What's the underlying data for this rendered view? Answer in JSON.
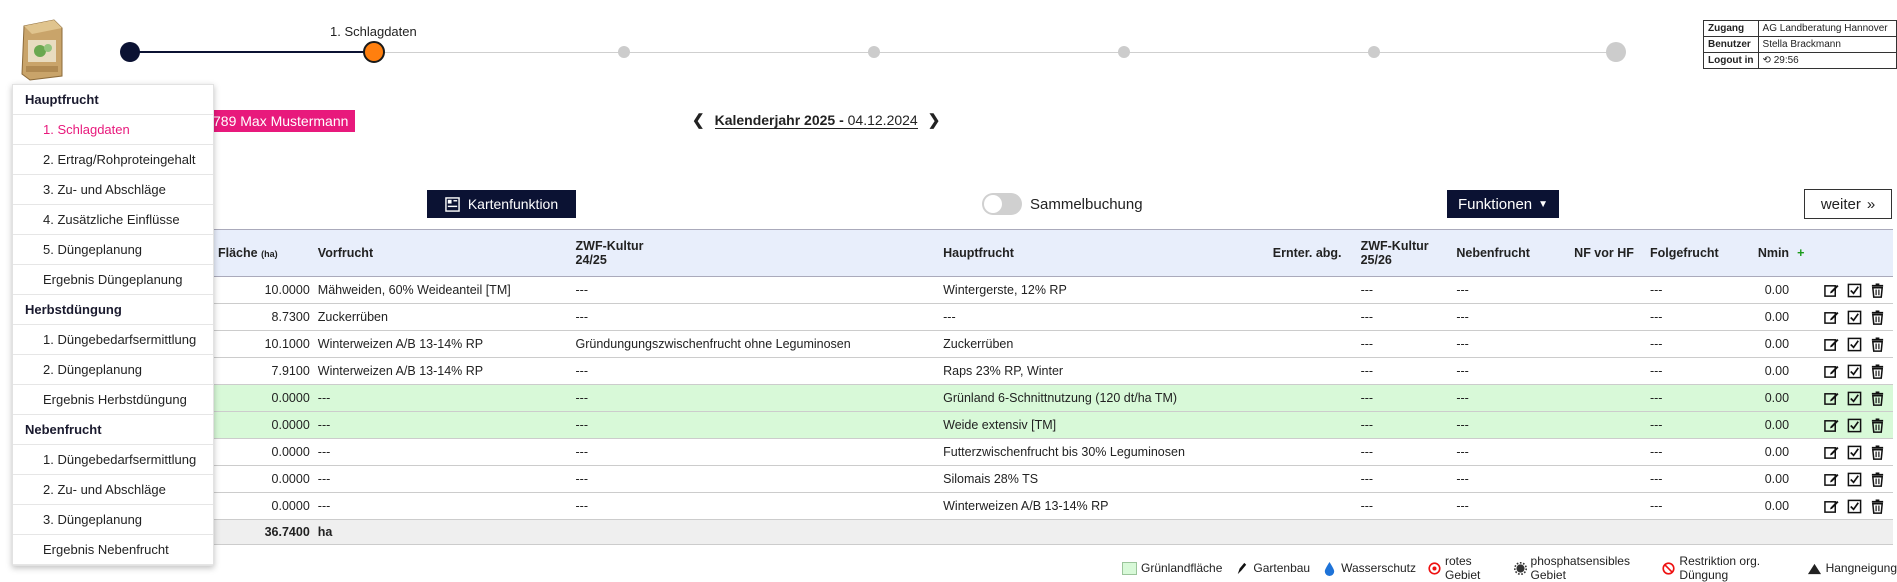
{
  "stepper": {
    "active_label": "1. Schlagdaten"
  },
  "session": [
    {
      "key": "Zugang",
      "value": "AG Landberatung Hannover"
    },
    {
      "key": "Benutzer",
      "value": "Stella Brackmann"
    },
    {
      "key": "Logout in",
      "value": "29:56"
    }
  ],
  "user_badge": "789 Max Mustermann",
  "year_nav": {
    "label": "Kalenderjahr 2025 - ",
    "date": "04.12.2024"
  },
  "toolbar": {
    "karten_label": "Kartenfunktion",
    "sammel_label": "Sammelbuchung",
    "funktionen_label": "Funktionen",
    "weiter_label": "weiter",
    "weiter_suffix": "»"
  },
  "table": {
    "headers": {
      "flaeche": "Fläche",
      "flaeche_unit": "(ha)",
      "vorfrucht": "Vorfrucht",
      "zwf1": "ZWF-Kultur",
      "zwf1_year": "24/25",
      "hauptfrucht": "Hauptfrucht",
      "ernter": "Ernter. abg.",
      "zwf2": "ZWF-Kultur",
      "zwf2_year": "25/26",
      "nebenfrucht": "Nebenfrucht",
      "nfvorhf": "NF vor HF",
      "folgefrucht": "Folgefrucht",
      "nmin": "Nmin",
      "add": "+"
    },
    "rows": [
      {
        "flaeche": "10.0000",
        "vorfrucht": "Mähweiden, 60% Weideanteil [TM]",
        "zwf1": "---",
        "hauptfrucht": "Wintergerste, 12% RP",
        "ernter": "",
        "zwf2": "---",
        "nebenfrucht": "---",
        "nfvorhf": "",
        "folgefrucht": "---",
        "nmin": "0.00",
        "green": false
      },
      {
        "flaeche": "8.7300",
        "vorfrucht": "Zuckerrüben",
        "zwf1": "---",
        "hauptfrucht": "---",
        "ernter": "",
        "zwf2": "---",
        "nebenfrucht": "---",
        "nfvorhf": "",
        "folgefrucht": "---",
        "nmin": "0.00",
        "green": false
      },
      {
        "flaeche": "10.1000",
        "vorfrucht": "Winterweizen A/B 13-14% RP",
        "zwf1": "Gründungungszwischenfrucht ohne Leguminosen",
        "hauptfrucht": "Zuckerrüben",
        "ernter": "",
        "zwf2": "---",
        "nebenfrucht": "---",
        "nfvorhf": "",
        "folgefrucht": "---",
        "nmin": "0.00",
        "green": false
      },
      {
        "flaeche": "7.9100",
        "vorfrucht": "Winterweizen A/B 13-14% RP",
        "zwf1": "---",
        "hauptfrucht": "Raps 23% RP, Winter",
        "ernter": "",
        "zwf2": "---",
        "nebenfrucht": "---",
        "nfvorhf": "",
        "folgefrucht": "---",
        "nmin": "0.00",
        "green": false
      },
      {
        "flaeche": "0.0000",
        "vorfrucht": "---",
        "zwf1": "---",
        "hauptfrucht": "Grünland 6-Schnittnutzung (120 dt/ha TM)",
        "ernter": "",
        "zwf2": "---",
        "nebenfrucht": "---",
        "nfvorhf": "",
        "folgefrucht": "---",
        "nmin": "0.00",
        "green": true
      },
      {
        "flaeche": "0.0000",
        "vorfrucht": "---",
        "zwf1": "---",
        "hauptfrucht": "Weide extensiv [TM]",
        "ernter": "",
        "zwf2": "---",
        "nebenfrucht": "---",
        "nfvorhf": "",
        "folgefrucht": "---",
        "nmin": "0.00",
        "green": true
      },
      {
        "flaeche": "0.0000",
        "vorfrucht": "---",
        "zwf1": "---",
        "hauptfrucht": "Futterzwischenfrucht bis 30% Leguminosen",
        "ernter": "",
        "zwf2": "---",
        "nebenfrucht": "---",
        "nfvorhf": "",
        "folgefrucht": "---",
        "nmin": "0.00",
        "green": false
      },
      {
        "flaeche": "0.0000",
        "vorfrucht": "---",
        "zwf1": "---",
        "hauptfrucht": "Silomais 28% TS",
        "ernter": "",
        "zwf2": "---",
        "nebenfrucht": "---",
        "nfvorhf": "",
        "folgefrucht": "---",
        "nmin": "0.00",
        "green": false
      },
      {
        "flaeche": "0.0000",
        "vorfrucht": "---",
        "zwf1": "---",
        "hauptfrucht": "Winterweizen A/B 13-14% RP",
        "ernter": "",
        "zwf2": "---",
        "nebenfrucht": "---",
        "nfvorhf": "",
        "folgefrucht": "---",
        "nmin": "0.00",
        "green": false
      }
    ],
    "total": {
      "flaeche": "36.7400",
      "unit": "ha"
    }
  },
  "menu": [
    {
      "type": "section",
      "label": "Hauptfrucht"
    },
    {
      "type": "item",
      "label": "1. Schlagdaten",
      "active": true
    },
    {
      "type": "item",
      "label": "2. Ertrag/Rohproteingehalt"
    },
    {
      "type": "item",
      "label": "3. Zu- und Abschläge"
    },
    {
      "type": "item",
      "label": "4. Zusätzliche Einflüsse"
    },
    {
      "type": "item",
      "label": "5. Düngeplanung"
    },
    {
      "type": "item",
      "label": "Ergebnis Düngeplanung"
    },
    {
      "type": "section",
      "label": "Herbstdüngung"
    },
    {
      "type": "item",
      "label": "1. Düngebedarfsermittlung"
    },
    {
      "type": "item",
      "label": "2. Düngeplanung"
    },
    {
      "type": "item",
      "label": "Ergebnis Herbstdüngung"
    },
    {
      "type": "section",
      "label": "Nebenfrucht"
    },
    {
      "type": "item",
      "label": "1. Düngebedarfsermittlung"
    },
    {
      "type": "item",
      "label": "2. Zu- und Abschläge"
    },
    {
      "type": "item",
      "label": "3. Düngeplanung"
    },
    {
      "type": "item",
      "label": "Ergebnis Nebenfrucht"
    }
  ],
  "legend": [
    {
      "icon": "green-swatch",
      "label": "Grünlandfläche"
    },
    {
      "icon": "pen-icon",
      "label": "Gartenbau"
    },
    {
      "icon": "droplet-icon",
      "label": "Wasserschutz"
    },
    {
      "icon": "target-icon",
      "label": "rotes Gebiet"
    },
    {
      "icon": "gear-icon",
      "label": "phosphatsensibles Gebiet"
    },
    {
      "icon": "no-entry-icon",
      "label": "Restriktion org. Düngung"
    },
    {
      "icon": "triangle-icon",
      "label": "Hangneigung"
    }
  ],
  "colors": {
    "navy": "#0b1233",
    "accent_pink": "#e8197c",
    "active_step": "#ff7f0e",
    "green_row": "#d8f9d8",
    "header_bg": "#e8eefb",
    "add_green": "#1a9b1a"
  }
}
